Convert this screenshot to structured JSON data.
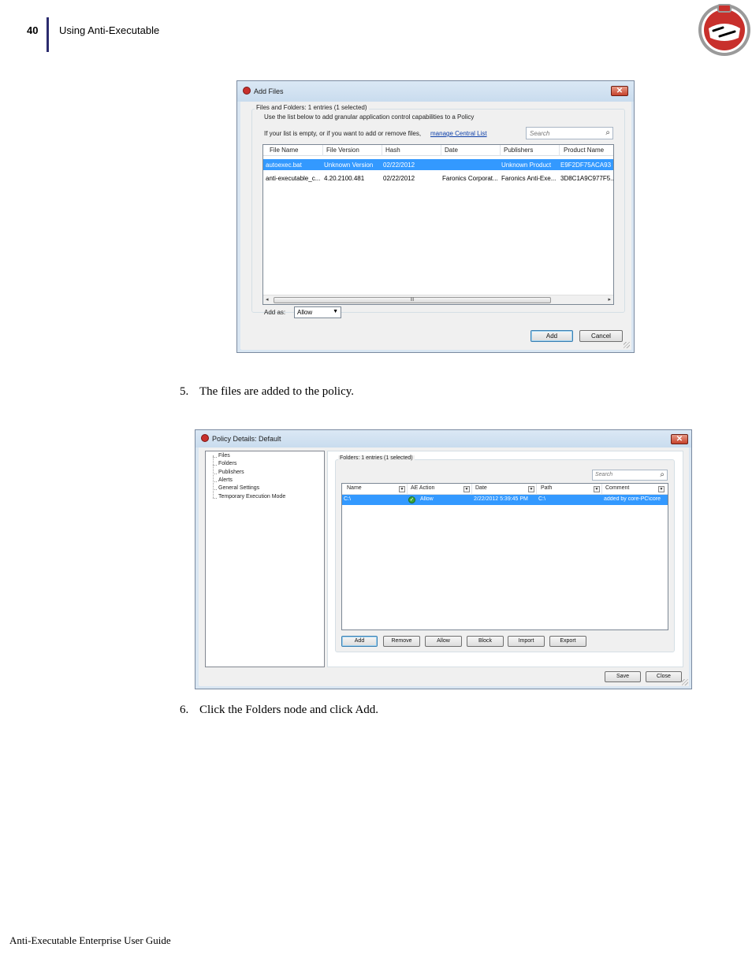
{
  "header": {
    "page_number": "40",
    "section_title": "Using Anti-Executable"
  },
  "add_files_dialog": {
    "title": "Add Files",
    "close_glyph": "✕",
    "group_label": "Files and Folders: 1 entries (1 selected)",
    "instruction": "Use the list below to add granular application control capabilities to a Policy",
    "empty_hint": "If your list is empty, or if you want to add or remove files,",
    "manage_link": "manage Central List",
    "search_placeholder": "Search",
    "columns": [
      "File Name",
      "File Version",
      "Hash",
      "Date",
      "Publishers",
      "Product Name"
    ],
    "rows": [
      {
        "file_name": "autoexec.bat",
        "file_version": "Unknown Version",
        "hash": "",
        "date": "02/22/2012",
        "publishers": "",
        "product_name": "Unknown Product",
        "extra": "E9F2DF75ACA93",
        "selected": true
      },
      {
        "file_name": "anti-executable_c...",
        "file_version": "4.20.2100.481",
        "hash": "",
        "date": "02/22/2012",
        "publishers": "Faronics Corporat...",
        "product_name": "Faronics Anti-Exe...",
        "extra": "3D8C1A9C977F5...",
        "selected": false
      }
    ],
    "scroll_thumb": "III",
    "add_as_label": "Add as:",
    "add_as_value": "Allow",
    "add_button": "Add",
    "cancel_button": "Cancel"
  },
  "step5": {
    "number": "5.",
    "text": "The files are added to the policy."
  },
  "policy_dialog": {
    "title": "Policy Details: Default",
    "close_glyph": "✕",
    "tree": [
      "Files",
      "Folders",
      "Publishers",
      "Alerts",
      "General Settings",
      "Temporary Execution Mode"
    ],
    "group_label": "Folders: 1 entries (1 selected)",
    "search_placeholder": "Search",
    "columns": [
      "Name",
      "AE Action",
      "Date",
      "Path",
      "Comment"
    ],
    "rows": [
      {
        "name": "C:\\",
        "action": "Allow",
        "date": "2/22/2012 5:39:45 PM",
        "path": "C:\\",
        "comment": "added by core-PC\\core"
      }
    ],
    "buttons": [
      "Add",
      "Remove",
      "Allow",
      "Block",
      "Import",
      "Export"
    ],
    "save_button": "Save",
    "close_button": "Close"
  },
  "step6": {
    "number": "6.",
    "text": "Click the Folders node and click Add."
  },
  "footer": {
    "text": "Anti-Executable Enterprise User Guide"
  },
  "colors": {
    "header_bar": "#2b2b6e",
    "selection": "#3399ff",
    "link": "#0b3ea8",
    "logo_red": "#c8302c"
  }
}
